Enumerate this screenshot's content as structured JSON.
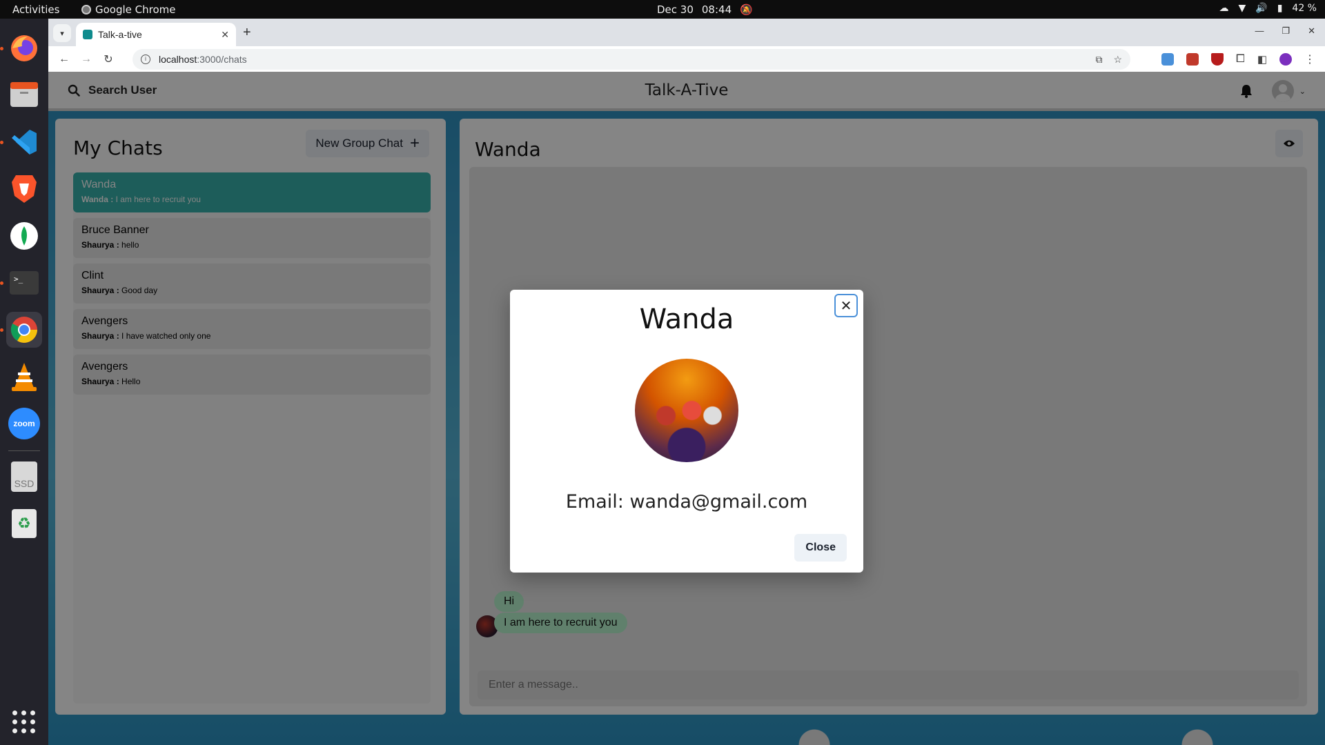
{
  "os": {
    "activities": "Activities",
    "app_name": "Google Chrome",
    "date": "Dec 30",
    "time": "08:44",
    "battery": "42 %"
  },
  "dock": {
    "items": [
      "firefox",
      "files",
      "vscode",
      "brave",
      "mongodb-compass",
      "terminal",
      "chrome",
      "vlc",
      "zoom",
      "ssd",
      "trash"
    ],
    "zoom_label": "zoom",
    "ssd_label": "SSD"
  },
  "browser": {
    "tab_title": "Talk-a-tive",
    "url_host": "localhost",
    "url_path": ":3000/chats"
  },
  "app": {
    "search_label": "Search User",
    "brand": "Talk-A-Tive"
  },
  "my_chats": {
    "title": "My Chats",
    "new_group_label": "New Group Chat",
    "items": [
      {
        "name": "Wanda",
        "sender": "Wanda :",
        "text": "I am here to recruit you",
        "selected": true
      },
      {
        "name": "Bruce Banner",
        "sender": "Shaurya :",
        "text": "hello"
      },
      {
        "name": "Clint",
        "sender": "Shaurya :",
        "text": "Good day"
      },
      {
        "name": "Avengers",
        "sender": "Shaurya :",
        "text": "I have watched only one"
      },
      {
        "name": "Avengers",
        "sender": "Shaurya :",
        "text": "Hello"
      }
    ]
  },
  "chat": {
    "title": "Wanda",
    "messages": [
      {
        "text": "Hi"
      },
      {
        "text": "I am here to recruit you"
      }
    ],
    "input_placeholder": "Enter a message.."
  },
  "modal": {
    "title": "Wanda",
    "email": "Email: wanda@gmail.com",
    "close_label": "Close"
  },
  "colors": {
    "accent": "#38b2ac",
    "message_bubble": "#b9f5d0"
  }
}
